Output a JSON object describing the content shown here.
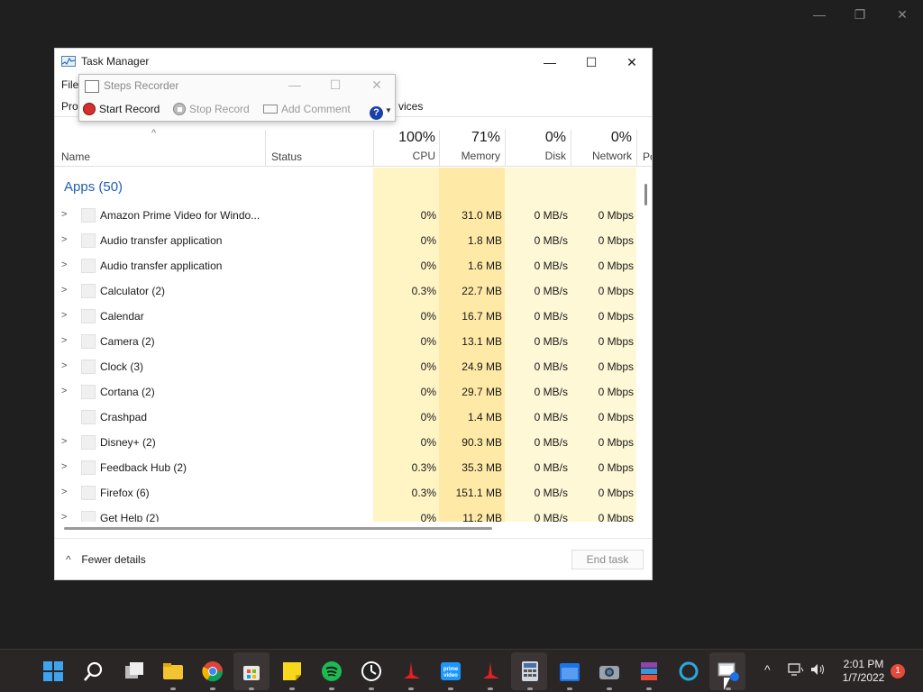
{
  "host_window": {
    "minimize": "—",
    "restore": "❐",
    "close": "✕"
  },
  "task_manager": {
    "title": "Task Manager",
    "controls": {
      "minimize": "—",
      "maximize": "☐",
      "close": "✕"
    },
    "menu_partial": "File",
    "tab_partial_left": "Pro",
    "tab_partial_right": "vices",
    "columns": {
      "name": "Name",
      "status": "Status",
      "cpu": {
        "pct": "100%",
        "label": "CPU"
      },
      "memory": {
        "pct": "71%",
        "label": "Memory"
      },
      "disk": {
        "pct": "0%",
        "label": "Disk"
      },
      "network": {
        "pct": "0%",
        "label": "Network"
      },
      "power_partial": "Po"
    },
    "group": "Apps (50)",
    "rows": [
      {
        "name": "Amazon Prime Video for Windo...",
        "expand": true,
        "cpu": "0%",
        "memory": "31.0 MB",
        "disk": "0 MB/s",
        "network": "0 Mbps"
      },
      {
        "name": "Audio transfer application",
        "expand": true,
        "cpu": "0%",
        "memory": "1.8 MB",
        "disk": "0 MB/s",
        "network": "0 Mbps"
      },
      {
        "name": "Audio transfer application",
        "expand": true,
        "cpu": "0%",
        "memory": "1.6 MB",
        "disk": "0 MB/s",
        "network": "0 Mbps"
      },
      {
        "name": "Calculator (2)",
        "expand": true,
        "cpu": "0.3%",
        "memory": "22.7 MB",
        "disk": "0 MB/s",
        "network": "0 Mbps"
      },
      {
        "name": "Calendar",
        "expand": true,
        "cpu": "0%",
        "memory": "16.7 MB",
        "disk": "0 MB/s",
        "network": "0 Mbps"
      },
      {
        "name": "Camera (2)",
        "expand": true,
        "cpu": "0%",
        "memory": "13.1 MB",
        "disk": "0 MB/s",
        "network": "0 Mbps"
      },
      {
        "name": "Clock (3)",
        "expand": true,
        "cpu": "0%",
        "memory": "24.9 MB",
        "disk": "0 MB/s",
        "network": "0 Mbps"
      },
      {
        "name": "Cortana (2)",
        "expand": true,
        "cpu": "0%",
        "memory": "29.7 MB",
        "disk": "0 MB/s",
        "network": "0 Mbps"
      },
      {
        "name": "Crashpad",
        "expand": false,
        "cpu": "0%",
        "memory": "1.4 MB",
        "disk": "0 MB/s",
        "network": "0 Mbps"
      },
      {
        "name": "Disney+ (2)",
        "expand": true,
        "cpu": "0%",
        "memory": "90.3 MB",
        "disk": "0 MB/s",
        "network": "0 Mbps"
      },
      {
        "name": "Feedback Hub (2)",
        "expand": true,
        "cpu": "0.3%",
        "memory": "35.3 MB",
        "disk": "0 MB/s",
        "network": "0 Mbps"
      },
      {
        "name": "Firefox (6)",
        "expand": true,
        "cpu": "0.3%",
        "memory": "151.1 MB",
        "disk": "0 MB/s",
        "network": "0 Mbps"
      },
      {
        "name": "Get Help (2)",
        "expand": true,
        "cpu": "0%",
        "memory": "11.2 MB",
        "disk": "0 MB/s",
        "network": "0 Mbps"
      }
    ],
    "footer": {
      "fewer_details": "Fewer details",
      "end_task": "End task"
    }
  },
  "steps_recorder": {
    "title": "Steps Recorder",
    "controls": {
      "minimize": "—",
      "maximize": "☐",
      "close": "✕"
    },
    "start_record": "Start Record",
    "stop_record": "Stop Record",
    "add_comment": "Add Comment",
    "help": "?"
  },
  "taskbar": {
    "apps": [
      "start-icon",
      "search-icon",
      "task-view-icon",
      "file-explorer-icon",
      "chrome-icon",
      "microsoft-store-icon",
      "sticky-notes-icon",
      "spotify-icon",
      "clock-icon",
      "red-app-icon",
      "prime-video-icon",
      "red-app-2-icon",
      "calculator-icon",
      "calendar-icon",
      "camera-icon",
      "winrar-icon",
      "cortana-icon",
      "steps-recorder-icon"
    ],
    "clock_time": "2:01 PM",
    "clock_date": "1/7/2022",
    "notification_count": "1"
  },
  "colors": {
    "accent_blue": "#1f5fb0",
    "cpu_heat": "#fff4c4",
    "mem_heat": "#ffe9a6",
    "disk_net_heat": "#fff8d6",
    "taskbar_bg": "#2a2626",
    "desktop_bg": "#1f1f1f"
  }
}
